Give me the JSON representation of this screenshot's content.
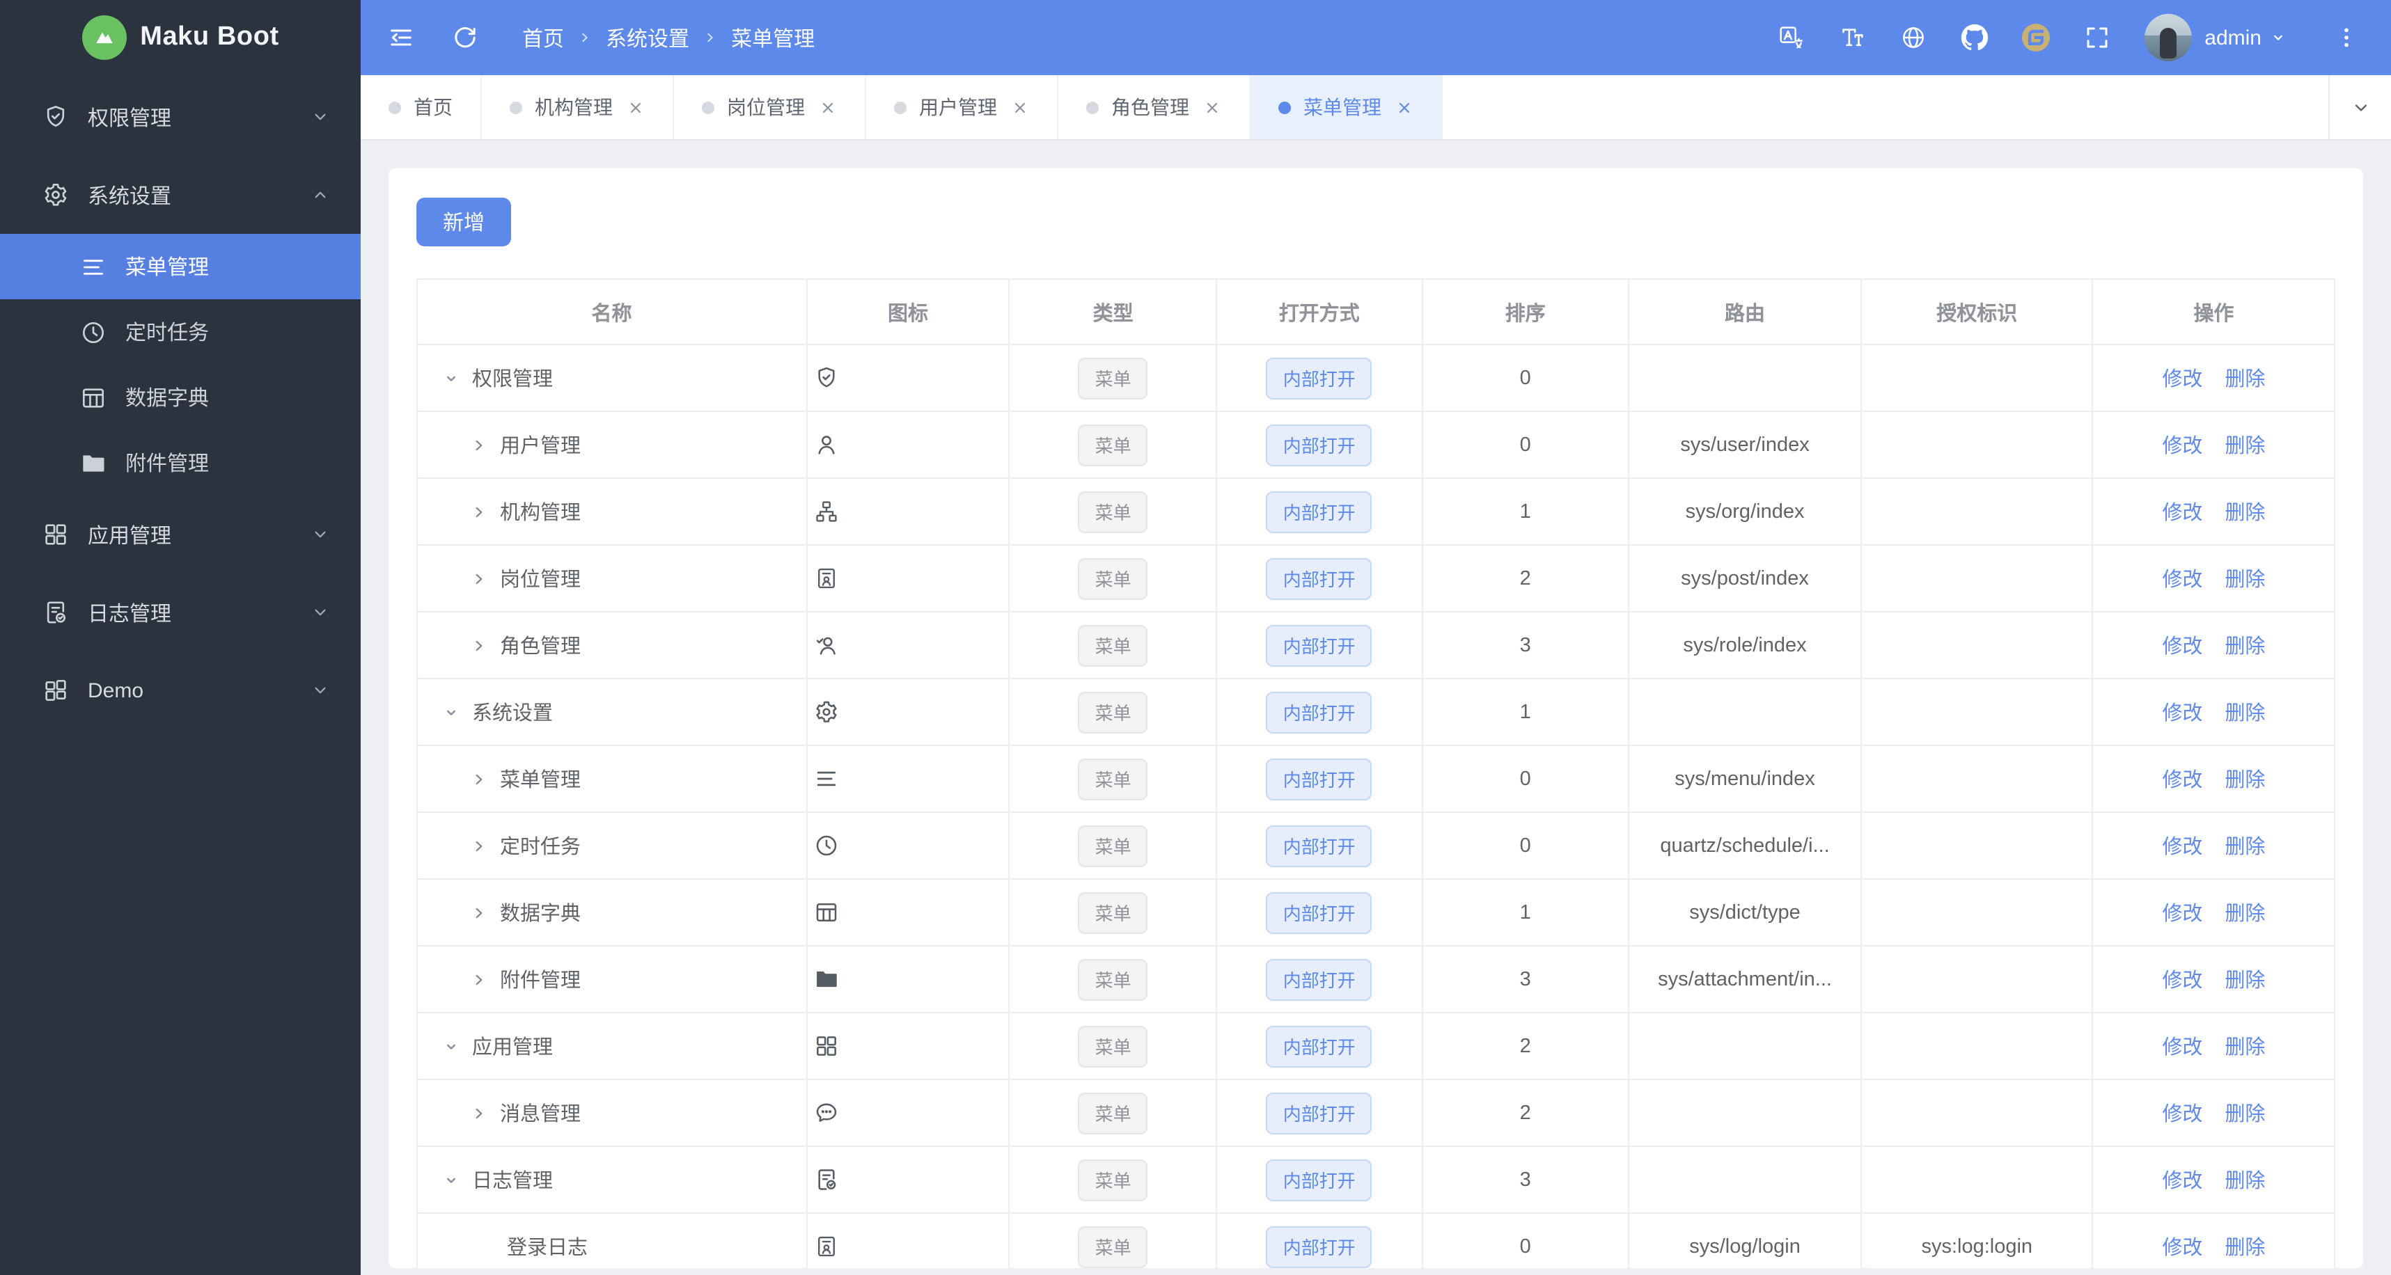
{
  "app": {
    "title": "Maku Boot",
    "logo_icon": "mountain-icon"
  },
  "colors": {
    "primary": "#5d89ea",
    "sidebar_bg": "#2b333e",
    "sidebar_active": "#5580e1",
    "navbar_bg": "#5d89ea",
    "content_bg": "#edeff3",
    "logo_green": "#69c162",
    "tag_info_text": "#8f9399",
    "tag_blue_text": "#5d89ea",
    "table_border": "#ebeef5"
  },
  "sidebar": {
    "items": [
      {
        "label": "权限管理",
        "icon": "shield-icon",
        "caret": "down"
      },
      {
        "label": "系统设置",
        "icon": "gear-icon",
        "caret": "up",
        "expanded": true,
        "children": [
          {
            "label": "菜单管理",
            "icon": "menu-icon",
            "active": true
          },
          {
            "label": "定时任务",
            "icon": "clock-icon"
          },
          {
            "label": "数据字典",
            "icon": "dict-icon"
          },
          {
            "label": "附件管理",
            "icon": "folder-icon"
          }
        ]
      },
      {
        "label": "应用管理",
        "icon": "grid-icon",
        "caret": "down"
      },
      {
        "label": "日志管理",
        "icon": "log-icon",
        "caret": "down"
      },
      {
        "label": "Demo",
        "icon": "grid2-icon",
        "caret": "down"
      }
    ]
  },
  "navbar": {
    "left_icons": [
      {
        "name": "fold-icon"
      },
      {
        "name": "refresh-icon"
      }
    ],
    "breadcrumb": [
      "首页",
      "系统设置",
      "菜单管理"
    ],
    "right_icons": [
      {
        "name": "translate-icon"
      },
      {
        "name": "fontsize-icon"
      },
      {
        "name": "globe-icon"
      },
      {
        "name": "github-icon"
      },
      {
        "name": "gitee-icon"
      },
      {
        "name": "fullscreen-icon"
      }
    ],
    "user": "admin",
    "user_caret": "caretdown-icon",
    "kebab": "kebab-icon"
  },
  "tabs": {
    "items": [
      {
        "label": "首页",
        "closable": false,
        "active": false
      },
      {
        "label": "机构管理",
        "closable": true,
        "active": false
      },
      {
        "label": "岗位管理",
        "closable": true,
        "active": false
      },
      {
        "label": "用户管理",
        "closable": true,
        "active": false
      },
      {
        "label": "角色管理",
        "closable": true,
        "active": false
      },
      {
        "label": "菜单管理",
        "closable": true,
        "active": true
      }
    ],
    "more_icon": "chevdown-icon"
  },
  "toolbar": {
    "add_label": "新增"
  },
  "table": {
    "headers": [
      "名称",
      "图标",
      "类型",
      "打开方式",
      "排序",
      "路由",
      "授权标识",
      "操作"
    ],
    "col_widths": [
      "20.3%",
      "10.6%",
      "10.8%",
      "10.7%",
      "10.8%",
      "12.1%",
      "12.1%",
      "12.6%"
    ],
    "actions": [
      "修改",
      "删除"
    ],
    "rows": [
      {
        "name": "权限管理",
        "level": 0,
        "arrow": "expanded",
        "icon": "shield-icon",
        "type": "菜单",
        "open": "内部打开",
        "sort": "0",
        "route": "",
        "auth": ""
      },
      {
        "name": "用户管理",
        "level": 1,
        "arrow": "collapsed",
        "icon": "user-icon",
        "type": "菜单",
        "open": "内部打开",
        "sort": "0",
        "route": "sys/user/index",
        "auth": ""
      },
      {
        "name": "机构管理",
        "level": 1,
        "arrow": "collapsed",
        "icon": "org-icon",
        "type": "菜单",
        "open": "内部打开",
        "sort": "1",
        "route": "sys/org/index",
        "auth": ""
      },
      {
        "name": "岗位管理",
        "level": 1,
        "arrow": "collapsed",
        "icon": "badge-icon",
        "type": "菜单",
        "open": "内部打开",
        "sort": "2",
        "route": "sys/post/index",
        "auth": ""
      },
      {
        "name": "角色管理",
        "level": 1,
        "arrow": "collapsed",
        "icon": "usercheck-icon",
        "type": "菜单",
        "open": "内部打开",
        "sort": "3",
        "route": "sys/role/index",
        "auth": ""
      },
      {
        "name": "系统设置",
        "level": 0,
        "arrow": "expanded",
        "icon": "gear-icon",
        "type": "菜单",
        "open": "内部打开",
        "sort": "1",
        "route": "",
        "auth": ""
      },
      {
        "name": "菜单管理",
        "level": 1,
        "arrow": "collapsed",
        "icon": "menu-icon",
        "type": "菜单",
        "open": "内部打开",
        "sort": "0",
        "route": "sys/menu/index",
        "auth": ""
      },
      {
        "name": "定时任务",
        "level": 1,
        "arrow": "collapsed",
        "icon": "clock-icon",
        "type": "菜单",
        "open": "内部打开",
        "sort": "0",
        "route": "quartz/schedule/i...",
        "auth": ""
      },
      {
        "name": "数据字典",
        "level": 1,
        "arrow": "collapsed",
        "icon": "dict-icon",
        "type": "菜单",
        "open": "内部打开",
        "sort": "1",
        "route": "sys/dict/type",
        "auth": ""
      },
      {
        "name": "附件管理",
        "level": 1,
        "arrow": "collapsed",
        "icon": "folder-icon",
        "type": "菜单",
        "open": "内部打开",
        "sort": "3",
        "route": "sys/attachment/in...",
        "auth": ""
      },
      {
        "name": "应用管理",
        "level": 0,
        "arrow": "expanded",
        "icon": "grid-icon",
        "type": "菜单",
        "open": "内部打开",
        "sort": "2",
        "route": "",
        "auth": ""
      },
      {
        "name": "消息管理",
        "level": 1,
        "arrow": "collapsed",
        "icon": "message-icon",
        "type": "菜单",
        "open": "内部打开",
        "sort": "2",
        "route": "",
        "auth": ""
      },
      {
        "name": "日志管理",
        "level": 0,
        "arrow": "expanded",
        "icon": "log-icon",
        "type": "菜单",
        "open": "内部打开",
        "sort": "3",
        "route": "",
        "auth": ""
      },
      {
        "name": "登录日志",
        "level": 2,
        "arrow": "none",
        "icon": "badge-icon",
        "type": "菜单",
        "open": "内部打开",
        "sort": "0",
        "route": "sys/log/login",
        "auth": "sys:log:login"
      }
    ]
  }
}
